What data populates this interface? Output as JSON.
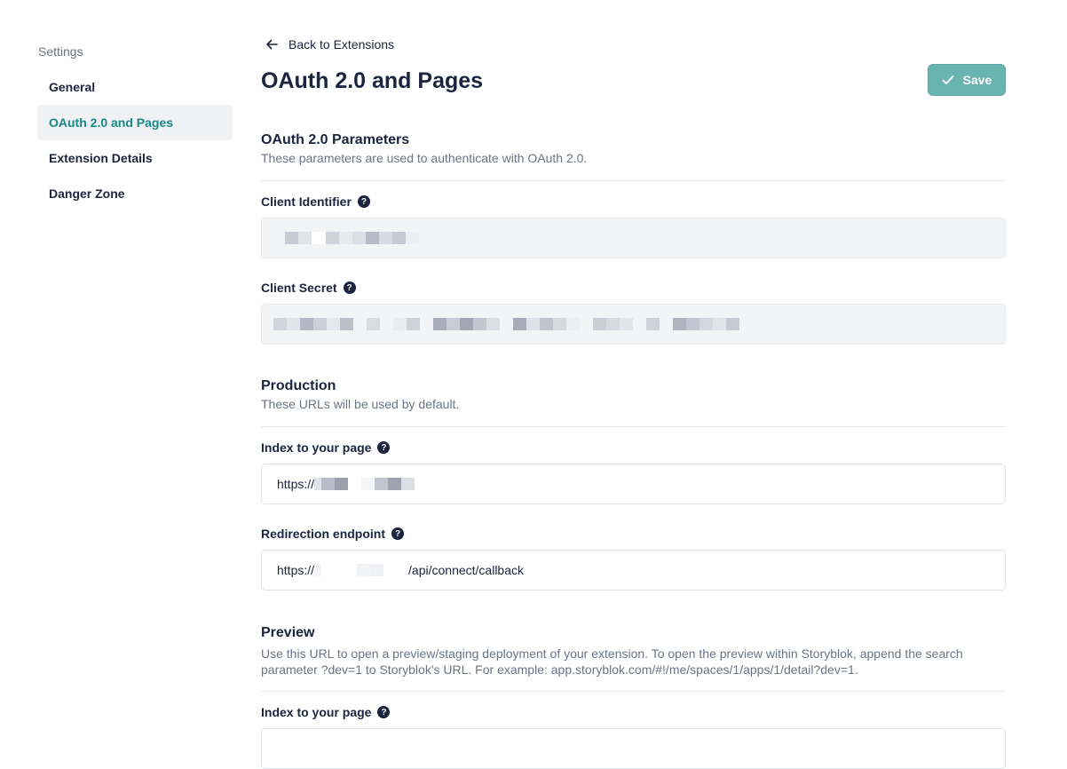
{
  "sidebar": {
    "heading": "Settings",
    "items": [
      {
        "label": "General",
        "active": false
      },
      {
        "label": "OAuth 2.0 and Pages",
        "active": true
      },
      {
        "label": "Extension Details",
        "active": false
      },
      {
        "label": "Danger Zone",
        "active": false
      }
    ]
  },
  "header": {
    "back_label": "Back to Extensions",
    "title": "OAuth 2.0 and Pages",
    "save_label": "Save"
  },
  "oauth": {
    "title": "OAuth 2.0 Parameters",
    "description": "These parameters are used to authenticate with OAuth 2.0.",
    "client_id_label": "Client Identifier",
    "client_secret_label": "Client Secret"
  },
  "production": {
    "title": "Production",
    "description": "These URLs will be used by default.",
    "index_label": "Index to your page",
    "index_value_prefix": "https://",
    "redirect_label": "Redirection endpoint",
    "redirect_value_prefix": "https://",
    "redirect_value_suffix": "/api/connect/callback"
  },
  "preview": {
    "title": "Preview",
    "description": "Use this URL to open a preview/staging deployment of your extension. To open the preview within Storyblok, append the search parameter ?dev=1 to Storyblok's URL. For example: app.storyblok.com/#!/me/spaces/1/apps/1/detail?dev=1.",
    "index_label": "Index to your page"
  },
  "colors": {
    "accent": "#178a86",
    "save_button": "#69b3b1",
    "text": "#1b243f",
    "muted": "#6b7385"
  }
}
